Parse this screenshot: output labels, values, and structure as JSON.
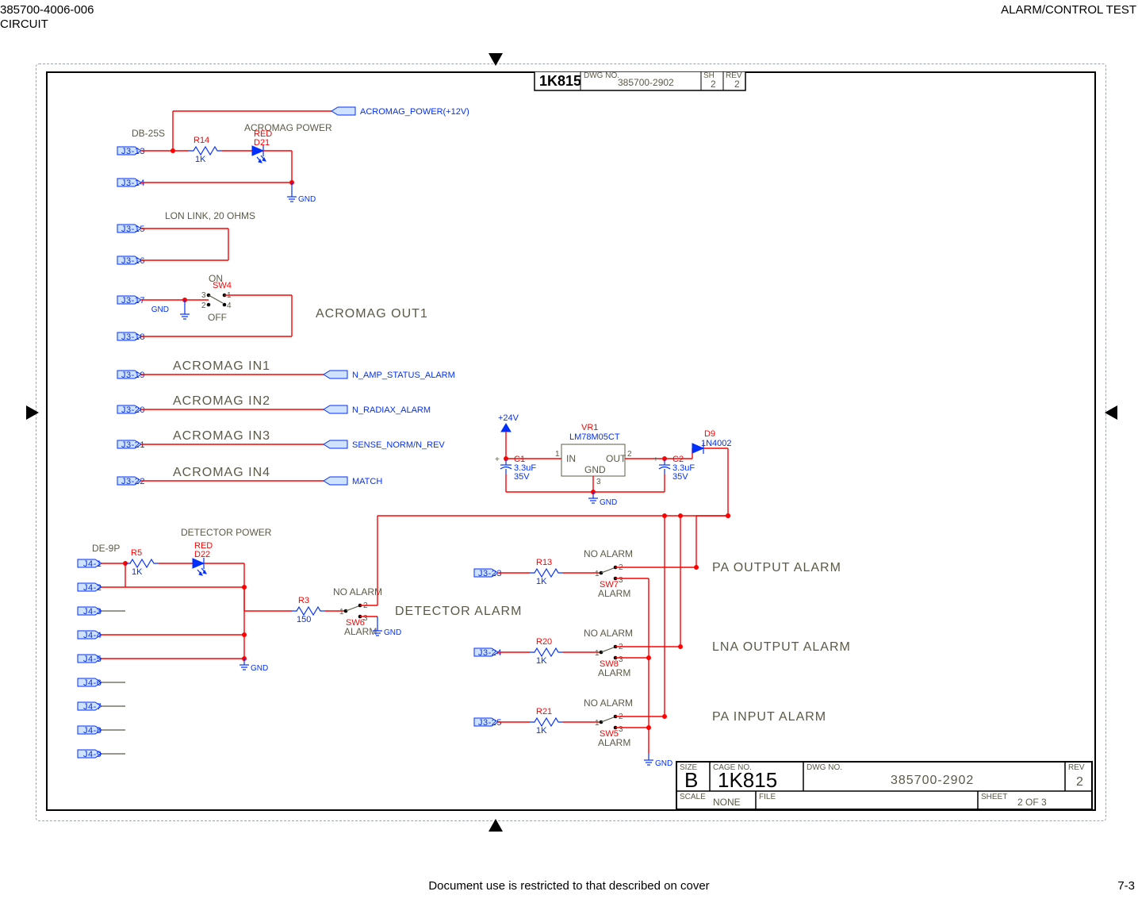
{
  "header": {
    "left_number": "385700-4006-006",
    "left_word": "CIRCUIT",
    "right": "ALARM/CONTROL TEST"
  },
  "footer": {
    "center": "Document use is restricted to that described on cover",
    "page": "7-3"
  },
  "top_block": {
    "cage": "1K815",
    "dwg_lbl": "DWG NO.",
    "dwg_no": "385700-2902",
    "sh_lbl": "SH",
    "sh_val": "2",
    "rev_lbl": "REV",
    "rev_val": "2"
  },
  "title_block": {
    "size_lbl": "SIZE",
    "size_val": "B",
    "cage_lbl": "CAGE NO.",
    "cage_val": "1K815",
    "dwg_lbl": "DWG NO.",
    "dwg_no": "385700-2902",
    "rev_lbl": "REV",
    "rev_val": "2",
    "scale_lbl": "SCALE",
    "scale_val": "NONE",
    "file_lbl": "FILE",
    "sheet_lbl": "SHEET",
    "sheet_val": "2 OF 3"
  },
  "pins_left": [
    "J3-13",
    "J3-14",
    "J3-15",
    "J3-16",
    "J3-17",
    "J3-18",
    "J3-19",
    "J3-20",
    "J3-21",
    "J3-22",
    "J4-1",
    "J4-2",
    "J4-3",
    "J4-4",
    "J4-5",
    "J4-6",
    "J4-7",
    "J4-8",
    "J4-9"
  ],
  "pins_mid": [
    "J3-23",
    "J3-24",
    "J3-25"
  ],
  "connectors": [
    "DB-25S",
    "DE-9P"
  ],
  "nets": [
    "ACROMAG_POWER(+12V)",
    "ACROMAG POWER",
    "GND",
    "LON LINK, 20 OHMS",
    "ON",
    "OFF",
    "ACROMAG OUT1",
    "ACROMAG IN1",
    "ACROMAG IN2",
    "ACROMAG IN3",
    "ACROMAG IN4",
    "N_AMP_STATUS_ALARM",
    "N_RADIAX_ALARM",
    "SENSE_NORM/N_REV",
    "MATCH",
    "DETECTOR POWER",
    "DETECTOR ALARM",
    "NO ALARM",
    "ALARM",
    "PA OUTPUT ALARM",
    "LNA OUTPUT ALARM",
    "PA INPUT ALARM",
    "+24V"
  ],
  "parts": {
    "R14": {
      "ref": "R14",
      "val": "1K"
    },
    "R5": {
      "ref": "R5",
      "val": "1K"
    },
    "R3": {
      "ref": "R3",
      "val": "150"
    },
    "R13": {
      "ref": "R13",
      "val": "1K"
    },
    "R20": {
      "ref": "R20",
      "val": "1K"
    },
    "R21": {
      "ref": "R21",
      "val": "1K"
    },
    "D21": {
      "ref": "D21",
      "color": "RED"
    },
    "D22": {
      "ref": "D22",
      "color": "RED"
    },
    "D9": {
      "ref": "D9",
      "val": "1N4002"
    },
    "VR1": {
      "ref": "VR1",
      "val": "LM78M05CT",
      "p1": "IN",
      "p2": "OUT",
      "p3": "GND",
      "pin1": "1",
      "pin2": "2",
      "pin3": "3"
    },
    "C1": {
      "ref": "C1",
      "val1": "3.3uF",
      "val2": "35V"
    },
    "C2": {
      "ref": "C2",
      "val1": "3.3uF",
      "val2": "35V"
    },
    "SW4": {
      "ref": "SW4",
      "p1": "1",
      "p2": "2",
      "p3": "3",
      "p4": "4"
    },
    "SW5": {
      "ref": "SW5",
      "p1": "1",
      "p2": "2",
      "p3": "3"
    },
    "SW6": {
      "ref": "SW6",
      "p1": "1",
      "p2": "2",
      "p3": "3"
    },
    "SW7": {
      "ref": "SW7",
      "p1": "1",
      "p2": "2",
      "p3": "3"
    },
    "SW8": {
      "ref": "SW8",
      "p1": "1",
      "p2": "2",
      "p3": "3"
    }
  }
}
